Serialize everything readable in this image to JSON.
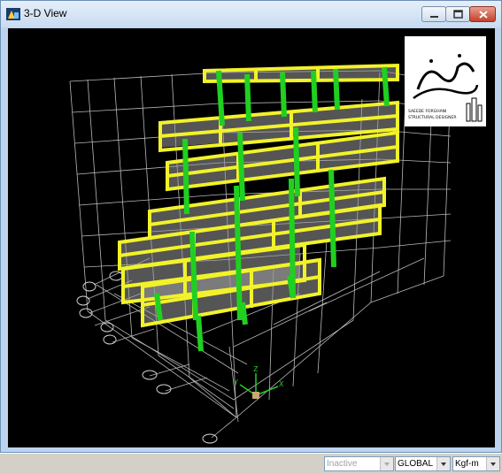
{
  "window": {
    "title": "3-D View"
  },
  "logo": {
    "name_text": "سعیده فرقانی",
    "caption_line1": "SAEEDE FORGHANI",
    "caption_line2": "STRUCTURAL DESIGNER"
  },
  "status": {
    "active_state": "Inactive",
    "coord_system": "GLOBAL",
    "units": "Kgf-m"
  },
  "axes": {
    "x": "X",
    "y": "Y",
    "z": "Z"
  },
  "colors": {
    "beams": "#f2f22a",
    "columns": "#20d020",
    "grid": "#c8c8c8",
    "background": "#000000",
    "bubbles": "#cfcfcf"
  }
}
